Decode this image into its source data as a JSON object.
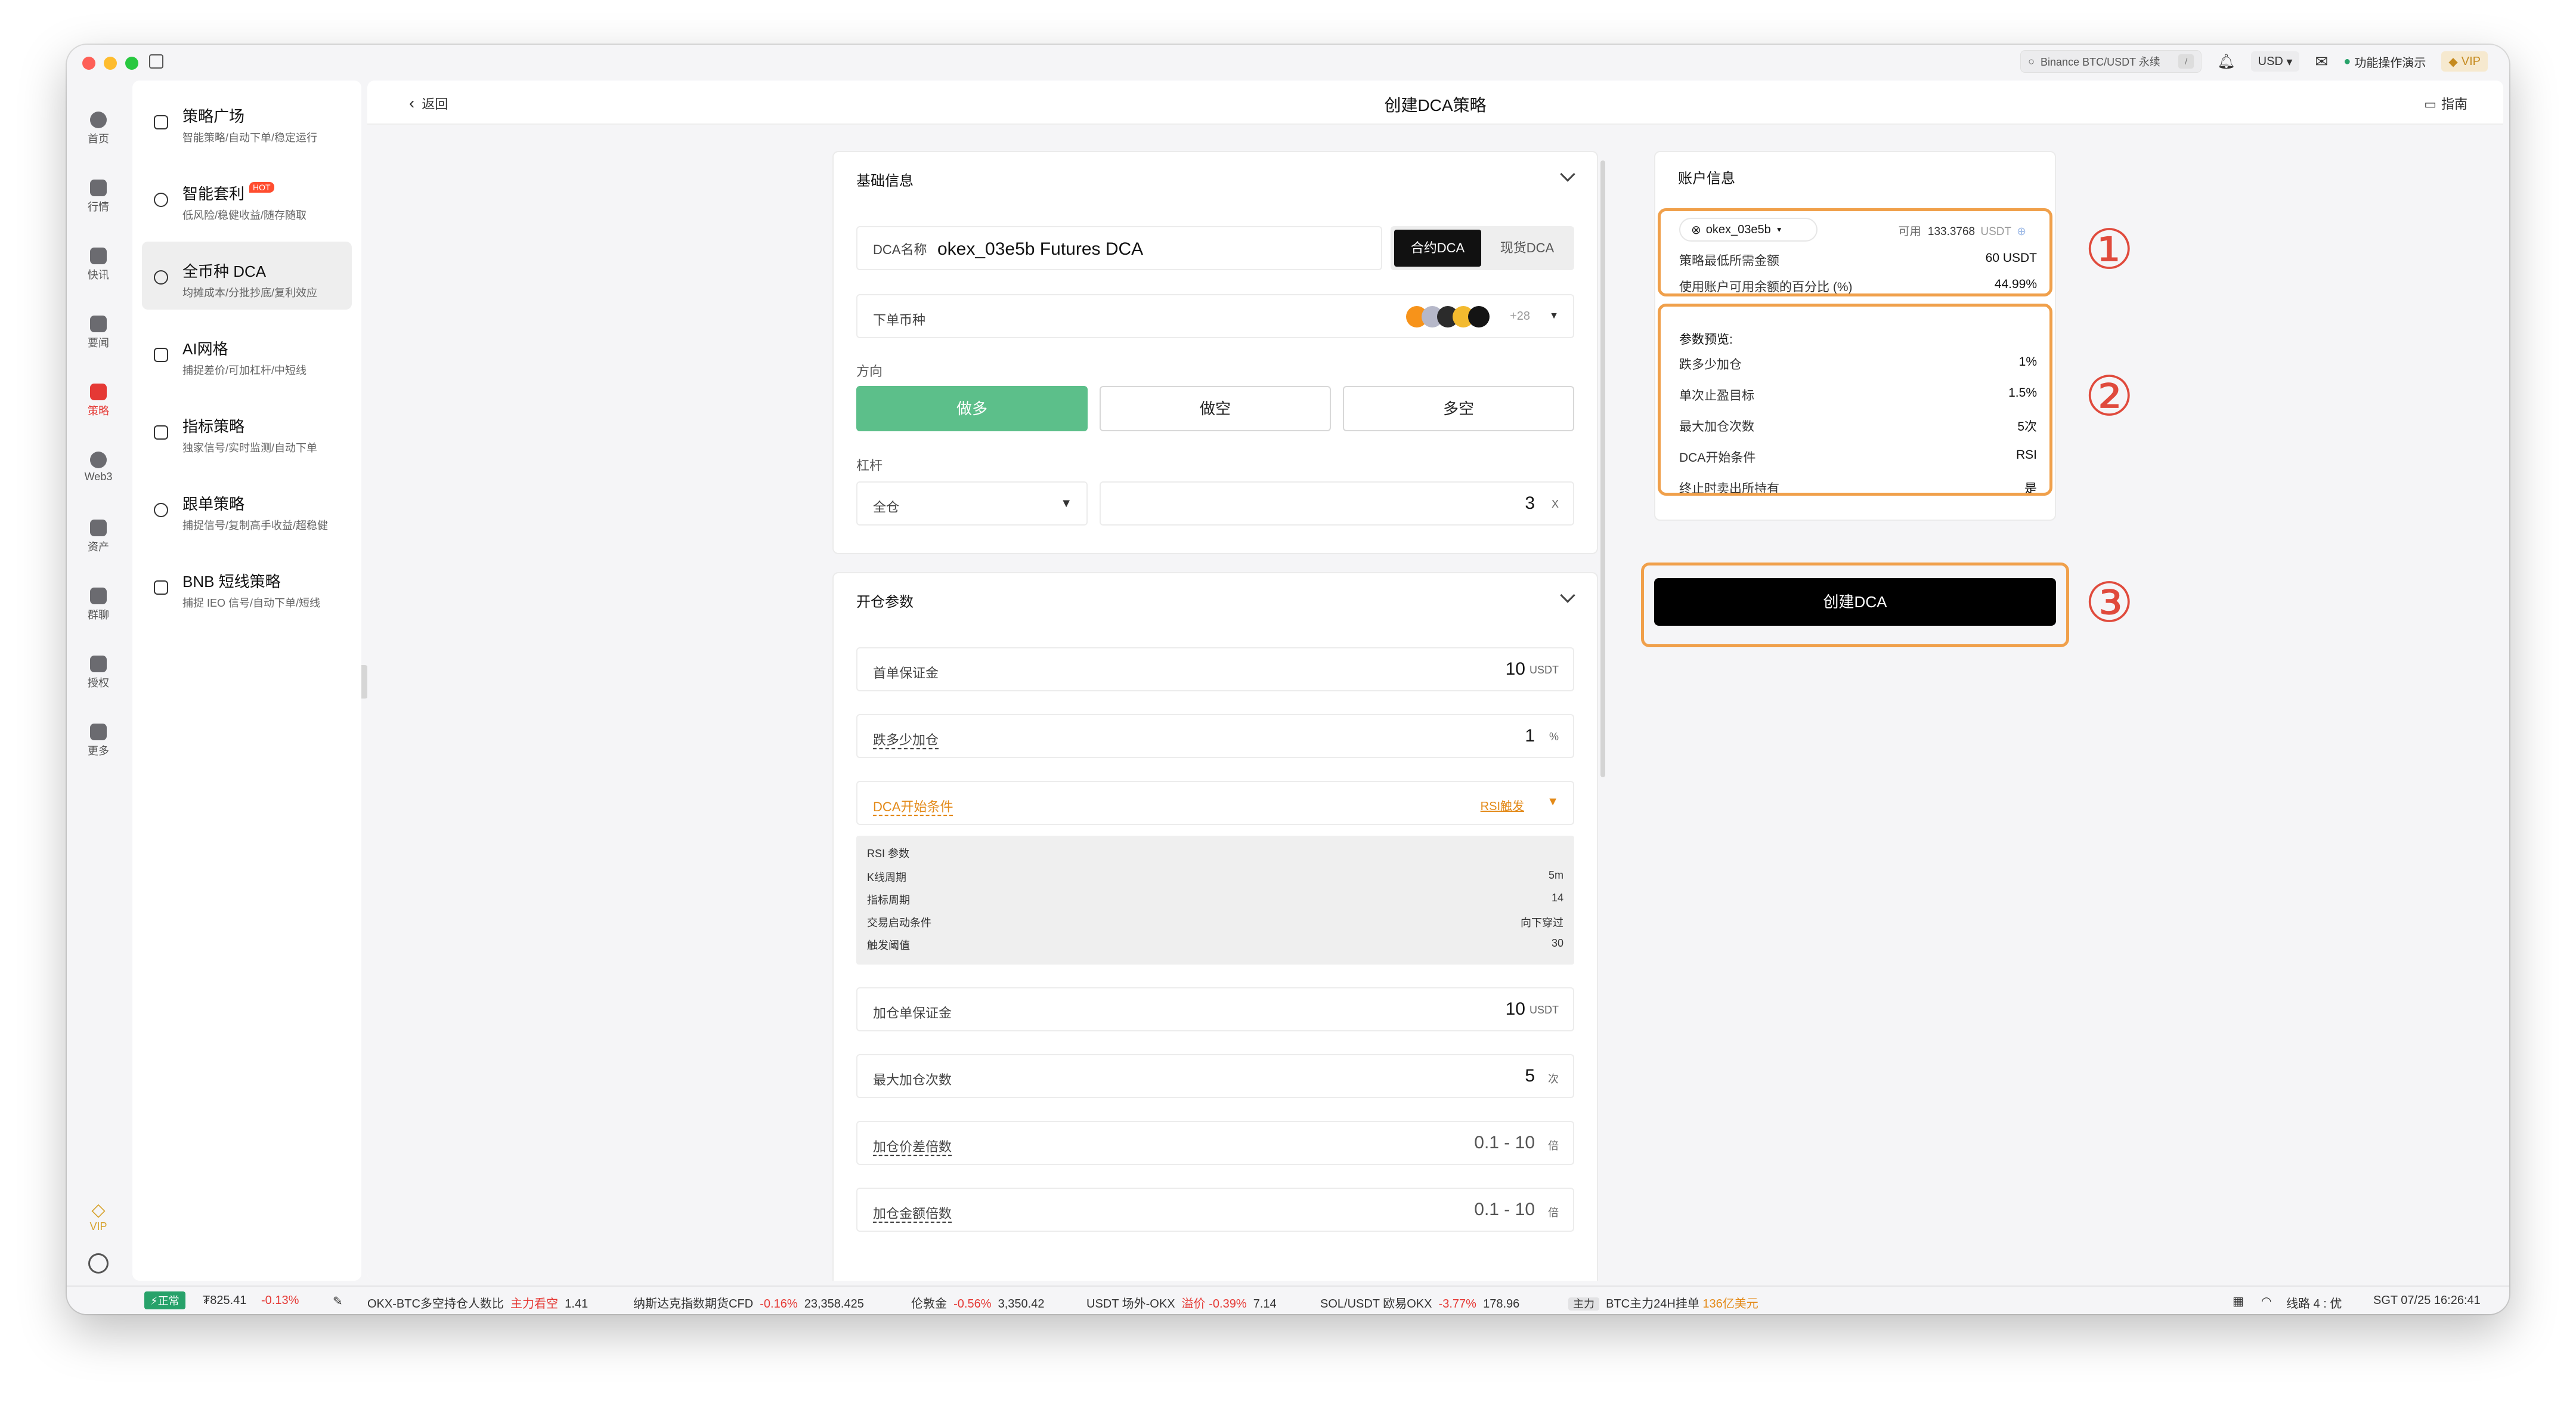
{
  "titlebar": {
    "search_text": "Binance BTC/USDT 永续",
    "search_shortcut": "/",
    "currency": "USD",
    "mode_label": "功能操作演示",
    "vip_label": "VIP"
  },
  "rail": {
    "items": [
      {
        "label": "首页",
        "icon": "home-icon"
      },
      {
        "label": "行情",
        "icon": "chart-icon"
      },
      {
        "label": "快讯",
        "icon": "news-icon"
      },
      {
        "label": "要闻",
        "icon": "document-icon"
      },
      {
        "label": "策略",
        "icon": "robot-icon",
        "active": true
      },
      {
        "label": "Web3",
        "icon": "web3-icon"
      },
      {
        "label": "资产",
        "icon": "wallet-icon"
      },
      {
        "label": "群聊",
        "icon": "chat-icon"
      },
      {
        "label": "授权",
        "icon": "image-icon"
      },
      {
        "label": "更多",
        "icon": "grid-icon"
      }
    ],
    "vip_label": "VIP"
  },
  "sidebar": {
    "items": [
      {
        "title": "策略广场",
        "desc": "智能策略/自动下单/稳定运行",
        "hot": ""
      },
      {
        "title": "智能套利",
        "desc": "低风险/稳健收益/随存随取",
        "hot": "HOT"
      },
      {
        "title": "全币种 DCA",
        "desc": "均摊成本/分批抄底/复利效应",
        "hot": ""
      },
      {
        "title": "AI网格",
        "desc": "捕捉差价/可加杠杆/中短线",
        "hot": ""
      },
      {
        "title": "指标策略",
        "desc": "独家信号/实时监测/自动下单",
        "hot": ""
      },
      {
        "title": "跟单策略",
        "desc": "捕捉信号/复制高手收益/超稳健",
        "hot": ""
      },
      {
        "title": "BNB 短线策略",
        "desc": "捕捉 IEO 信号/自动下单/短线",
        "hot": ""
      }
    ]
  },
  "header": {
    "back_label": "返回",
    "title": "创建DCA策略",
    "guide_label": "指南"
  },
  "basic": {
    "title": "基础信息",
    "name_label": "DCA名称",
    "name_value": "okex_03e5b Futures DCA",
    "tab_futures": "合约DCA",
    "tab_spot": "现货DCA",
    "coin_label": "下单币种",
    "coin_more": "+28",
    "direction_label": "方向",
    "dir_long": "做多",
    "dir_short": "做空",
    "dir_both": "多空",
    "leverage_label": "杠杆",
    "margin_mode": "全仓",
    "leverage_value": "3",
    "leverage_unit": "X"
  },
  "open": {
    "title": "开仓参数",
    "first_margin_label": "首单保证金",
    "first_margin_value": "10",
    "first_margin_unit": "USDT",
    "drop_add_label": "跌多少加仓",
    "drop_add_value": "1",
    "drop_add_unit": "%",
    "start_cond_label": "DCA开始条件",
    "start_cond_value": "RSI触发",
    "rsi": {
      "title": "RSI 参数",
      "rows": [
        {
          "k": "K线周期",
          "v": "5m"
        },
        {
          "k": "指标周期",
          "v": "14"
        },
        {
          "k": "交易启动条件",
          "v": "向下穿过"
        },
        {
          "k": "触发阈值",
          "v": "30"
        }
      ]
    },
    "add_margin_label": "加仓单保证金",
    "add_margin_value": "10",
    "add_margin_unit": "USDT",
    "max_add_label": "最大加仓次数",
    "max_add_value": "5",
    "max_add_unit": "次",
    "price_mult_label": "加仓价差倍数",
    "price_mult_value": "0.1 - 10",
    "price_mult_unit": "倍",
    "amount_mult_label": "加仓金额倍数",
    "amount_mult_value": "0.1 - 10",
    "amount_mult_unit": "倍"
  },
  "account": {
    "title": "账户信息",
    "account_name": "okex_03e5b",
    "available_label": "可用",
    "available_value": "133.3768",
    "available_unit": "USDT",
    "min_amount_label": "策略最低所需金额",
    "min_amount_value": "60 USDT",
    "pct_label": "使用账户可用余额的百分比 (%)",
    "pct_value": "44.99%",
    "preview_title": "参数预览:",
    "preview": [
      {
        "k": "跌多少加仓",
        "v": "1%"
      },
      {
        "k": "单次止盈目标",
        "v": "1.5%"
      },
      {
        "k": "最大加仓次数",
        "v": "5次"
      },
      {
        "k": "DCA开始条件",
        "v": "RSI"
      },
      {
        "k": "终止时卖出所持有",
        "v": "是"
      }
    ],
    "create_label": "创建DCA"
  },
  "annotations": {
    "one": "①",
    "two": "②",
    "three": "③"
  },
  "statusbar": {
    "normal_label": "正常",
    "btc_price": "₮825.41",
    "btc_change": "-0.13%",
    "item1_name": "OKX-BTC多空持仓人数比",
    "item1_tag": "主力看空",
    "item1_val": "1.41",
    "item2_name": "纳斯达克指数期货CFD",
    "item2_change": "-0.16%",
    "item2_val": "23,358.425",
    "item3_name": "伦敦金",
    "item3_change": "-0.56%",
    "item3_val": "3,350.42",
    "item4_name": "USDT 场外-OKX",
    "item4_tag": "溢价",
    "item4_change": "-0.39%",
    "item4_val": "7.14",
    "item5_name": "SOL/USDT 欧易OKX",
    "item5_change": "-3.77%",
    "item5_val": "178.96",
    "item6_tag": "主力",
    "item6_name": "BTC主力24H挂单",
    "item6_val": "136亿美元",
    "line_label": "线路 4 : 优",
    "time": "SGT 07/25 16:26:41"
  },
  "colors": {
    "accent_green": "#5cbf8a",
    "annotation_orange": "#f0a04b",
    "annotation_red": "#e04a3c",
    "primary_black": "#000000"
  }
}
